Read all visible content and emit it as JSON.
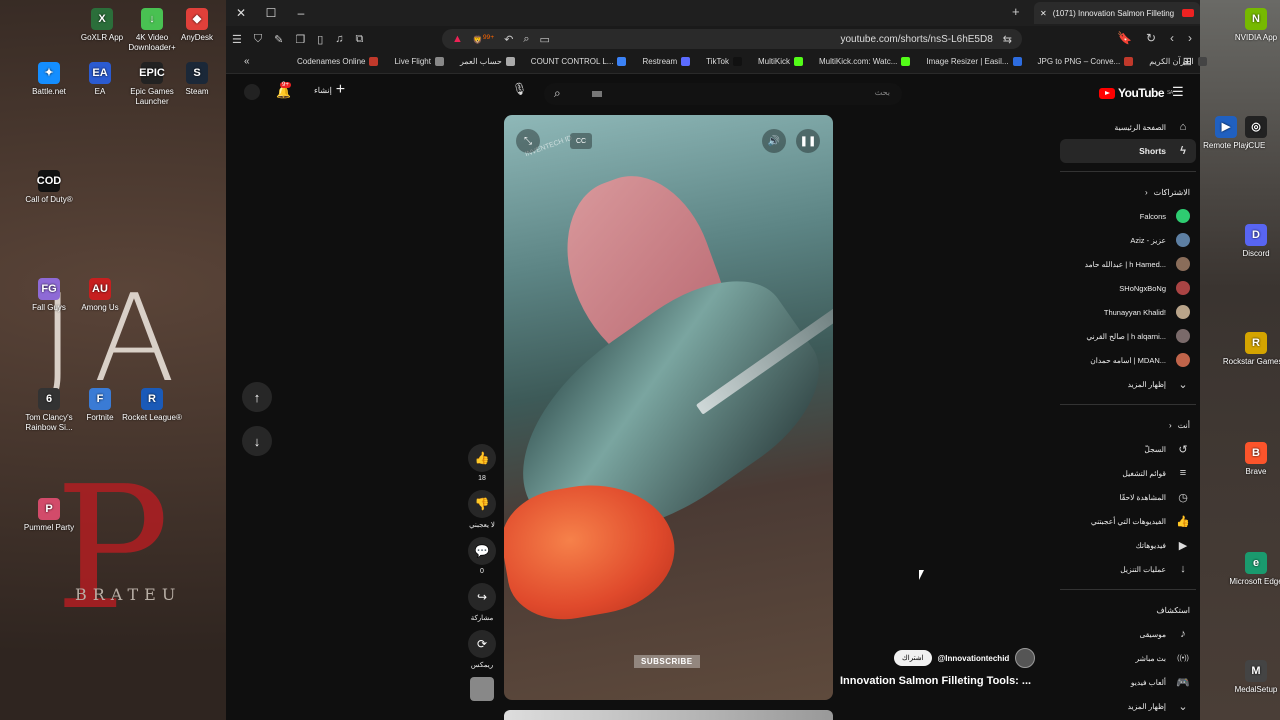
{
  "desktop": {
    "left_icons": [
      {
        "label": "GoXLR App",
        "color": "#2b6e3a",
        "glyph": "X"
      },
      {
        "label": "4K Video Downloader+",
        "color": "#49c152",
        "glyph": "↓"
      },
      {
        "label": "AnyDesk",
        "color": "#e0403a",
        "glyph": "◆"
      },
      {
        "label": "Battle.net",
        "color": "#148eff",
        "glyph": "✦"
      },
      {
        "label": "EA",
        "color": "#2b5bd1",
        "glyph": "EA"
      },
      {
        "label": "Epic Games Launcher",
        "color": "#222",
        "glyph": "EPIC"
      },
      {
        "label": "Steam",
        "color": "#1b2838",
        "glyph": "S"
      },
      {
        "label": "Call of Duty®",
        "color": "#111",
        "glyph": "COD"
      },
      {
        "label": "Fall Guys",
        "color": "#8e6ad6",
        "glyph": "FG"
      },
      {
        "label": "Among Us",
        "color": "#c71f1f",
        "glyph": "AU"
      },
      {
        "label": "Tom Clancy's Rainbow Si...",
        "color": "#333",
        "glyph": "6"
      },
      {
        "label": "Fortnite",
        "color": "#3a7bd5",
        "glyph": "F"
      },
      {
        "label": "Rocket League®",
        "color": "#1a5ab8",
        "glyph": "R"
      },
      {
        "label": "Pummel Party",
        "color": "#d24b6a",
        "glyph": "P"
      }
    ],
    "right_icons": [
      {
        "label": "NVIDIA App",
        "color": "#76b900",
        "glyph": "N"
      },
      {
        "label": "Remote Play",
        "color": "#2060c0",
        "glyph": "▶"
      },
      {
        "label": "iCUE",
        "color": "#222",
        "glyph": "◎"
      },
      {
        "label": "Discord",
        "color": "#5865f2",
        "glyph": "D"
      },
      {
        "label": "Rockstar Games...",
        "color": "#d4a400",
        "glyph": "R"
      },
      {
        "label": "Brave",
        "color": "#fb542b",
        "glyph": "B"
      },
      {
        "label": "Microsoft Edge",
        "color": "#1a9a6e",
        "glyph": "e"
      },
      {
        "label": "MedalSetup",
        "color": "#444",
        "glyph": "M"
      }
    ],
    "deco_text": "JA",
    "deco_red": "P",
    "deco_bottom": "BRATEU"
  },
  "browser": {
    "tab_title": "(1071) Innovation Salmon Filleting",
    "url": "youtube.com/shorts/nsS-L6hE5D8",
    "shield_count": "99+",
    "bookmarks": [
      {
        "label": "Codenames Online",
        "color": "#c0392b"
      },
      {
        "label": "Live Flight",
        "color": "#888"
      },
      {
        "label": "حساب العمر",
        "color": "#aaa"
      },
      {
        "label": "COUNT CONTROL L...",
        "color": "#3b82f6"
      },
      {
        "label": "Restream",
        "color": "#5b6bff"
      },
      {
        "label": "TikTok",
        "color": "#111"
      },
      {
        "label": "MultiKick",
        "color": "#53fc18"
      },
      {
        "label": "MultiKick.com: Watc...",
        "color": "#53fc18"
      },
      {
        "label": "Image Resizer | Easil...",
        "color": "#2d6cdf"
      },
      {
        "label": "JPG to PNG – Conve...",
        "color": "#c0392b"
      },
      {
        "label": "القرآن الكريم",
        "color": "#444"
      }
    ]
  },
  "youtube": {
    "logo": "YouTube",
    "logo_region": "SA",
    "search_placeholder": "بحث",
    "notification_count": "9+",
    "create_label": "إنشاء",
    "video": {
      "watermark": "INVENTECH ID",
      "subscribe_overlay": "SUBSCRIBE",
      "title": "Innovation Salmon Filleting Tools: ...",
      "channel": "@Innovationtechid",
      "subscribe_label": "اشتراك"
    },
    "actions": {
      "like_count": "18",
      "dislike_label": "لا يعجبني",
      "comment_count": "0",
      "share_label": "مشاركة",
      "remix_label": "ريمكس"
    },
    "sidebar": {
      "home": "الصفحة الرئيسية",
      "shorts": "Shorts",
      "subscriptions_header": "الاشتراكات",
      "subscriptions": [
        {
          "name": "Falcons",
          "color": "#2ecc71"
        },
        {
          "name": "Aziz - عزيز",
          "color": "#5d7fa3"
        },
        {
          "name": "عبدالله حامد | h Hamed...",
          "color": "#8a6d5a"
        },
        {
          "name": "SHoNgxBoNg",
          "color": "#aa4444"
        },
        {
          "name": "Thunayyan Khalid!",
          "color": "#b9a48a"
        },
        {
          "name": "صالح القرني | h alqarni...",
          "color": "#7a6a6a"
        },
        {
          "name": "اسامه حمدان | MDAN...",
          "color": "#c0644a"
        }
      ],
      "show_more": "إظهار المزيد",
      "you_header": "أنت",
      "you_items": [
        {
          "label": "السجلّ",
          "icon": "history-icon",
          "glyph": "↺"
        },
        {
          "label": "قوائم التشغيل",
          "icon": "playlist-icon",
          "glyph": "≡"
        },
        {
          "label": "المشاهدة لاحقًا",
          "icon": "clock-icon",
          "glyph": "◷"
        },
        {
          "label": "الفيديوهات التي أعجبتني",
          "icon": "like-icon",
          "glyph": "👍"
        },
        {
          "label": "فيديوهاتك",
          "icon": "your-videos-icon",
          "glyph": "▶"
        },
        {
          "label": "عمليات التنزيل",
          "icon": "download-icon",
          "glyph": "↓"
        }
      ],
      "explore_header": "استكشاف",
      "explore_items": [
        {
          "label": "موسيقى",
          "icon": "music-icon",
          "glyph": "♪"
        },
        {
          "label": "بث مباشر",
          "icon": "live-icon",
          "glyph": "((•))"
        },
        {
          "label": "ألعاب فيديو",
          "icon": "gaming-icon",
          "glyph": "🎮"
        },
        {
          "label": "إظهار المزيد",
          "icon": "chevron-down-icon",
          "glyph": "⌄"
        }
      ]
    }
  }
}
